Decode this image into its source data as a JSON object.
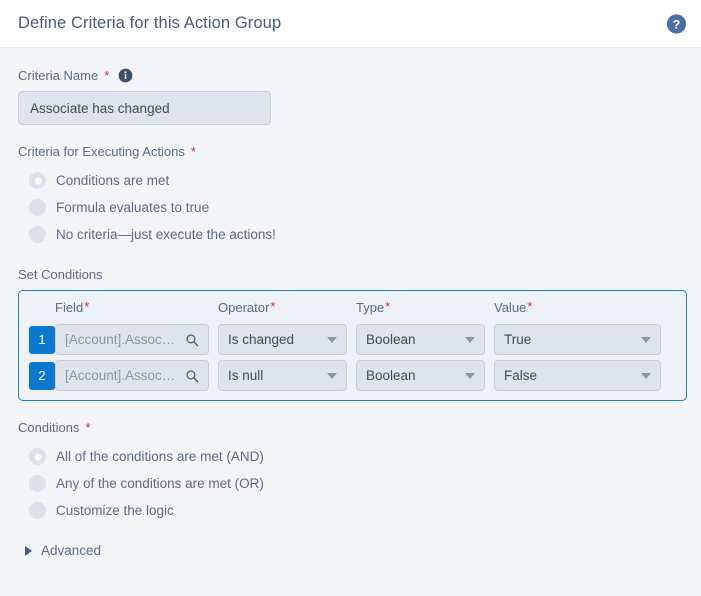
{
  "header": {
    "title": "Define Criteria for this Action Group",
    "help_icon": "help-circle-icon"
  },
  "criteria_name": {
    "label": "Criteria Name",
    "required_marker": "*",
    "info_icon": "info-circle-icon",
    "value": "Associate has changed"
  },
  "criteria_for_executing": {
    "label": "Criteria for Executing Actions",
    "required_marker": "*",
    "options": [
      {
        "label": "Conditions are met",
        "selected": true
      },
      {
        "label": "Formula evaluates to true",
        "selected": false
      },
      {
        "label": "No criteria—just execute the actions!",
        "selected": false
      }
    ]
  },
  "set_conditions": {
    "label": "Set Conditions",
    "columns": [
      {
        "label": "Field",
        "required_marker": "*"
      },
      {
        "label": "Operator",
        "required_marker": "*"
      },
      {
        "label": "Type",
        "required_marker": "*"
      },
      {
        "label": "Value",
        "required_marker": "*"
      }
    ],
    "rows": [
      {
        "number": "1",
        "field": "[Account].Assoc…",
        "field_icon": "search-icon",
        "operator": "Is changed",
        "type": "Boolean",
        "value": "True"
      },
      {
        "number": "2",
        "field": "[Account].Assoc…",
        "field_icon": "search-icon",
        "operator": "Is null",
        "type": "Boolean",
        "value": "False"
      }
    ]
  },
  "conditions_logic": {
    "label": "Conditions",
    "required_marker": "*",
    "options": [
      {
        "label": "All of the conditions are met (AND)",
        "selected": true
      },
      {
        "label": "Any of the conditions are met (OR)",
        "selected": false
      },
      {
        "label": "Customize the logic",
        "selected": false
      }
    ]
  },
  "advanced": {
    "label": "Advanced",
    "chevron_icon": "chevron-right-icon",
    "expanded": false
  },
  "colors": {
    "accent_blue": "#0b79d0",
    "panel_border": "#1b7fd4",
    "required_red": "#c23934",
    "page_bg": "#f3f5f9",
    "control_bg": "#dfe3ec"
  }
}
